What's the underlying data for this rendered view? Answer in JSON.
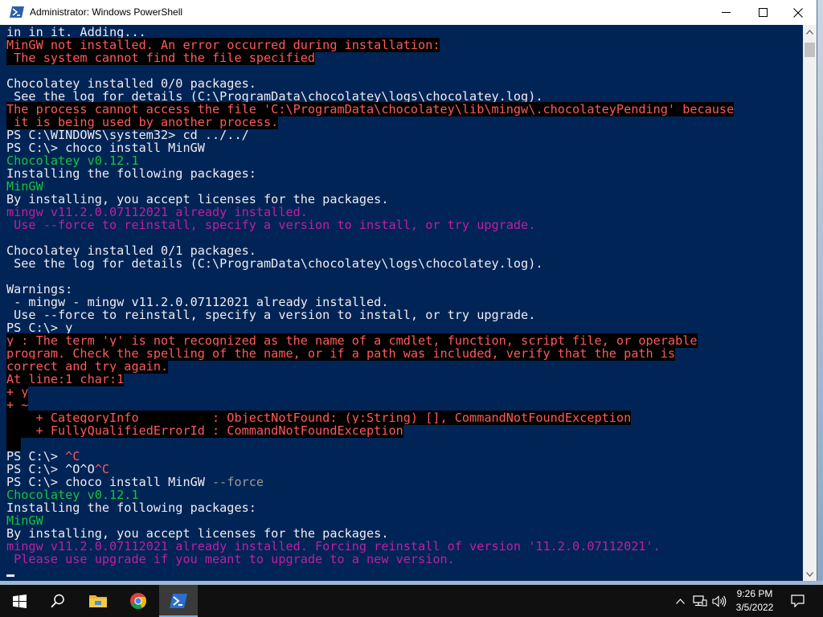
{
  "window": {
    "title": "Administrator: Windows PowerShell",
    "icon": "powershell-icon"
  },
  "caption_buttons": {
    "minimize": "minimize-icon",
    "maximize": "maximize-icon",
    "close": "close-icon"
  },
  "colors": {
    "console_background": "#012456",
    "text_default": "#eeedf0",
    "text_error": "#ff5a5a",
    "text_green": "#13c63c",
    "text_magenta": "#c01ea2",
    "text_parameter": "#9a9a9a",
    "error_background": "#000000"
  },
  "console": {
    "lines": [
      [
        {
          "t": "in in it. Adding...",
          "c": "white"
        }
      ],
      [
        {
          "t": "MinGW not installed. An error occurred during installation:",
          "c": "red",
          "bg": true
        }
      ],
      [
        {
          "t": " The system cannot find the file specified",
          "c": "red",
          "bg": true
        }
      ],
      [
        {
          "t": "",
          "c": "white"
        }
      ],
      [
        {
          "t": "Chocolatey installed 0/0 packages.",
          "c": "white"
        }
      ],
      [
        {
          "t": " See the log for details (C:\\ProgramData\\chocolatey\\logs\\chocolatey.log).",
          "c": "white"
        }
      ],
      [
        {
          "t": "The process cannot access the file 'C:\\ProgramData\\chocolatey\\lib\\mingw\\.chocolateyPending' because",
          "c": "red",
          "bg": true
        }
      ],
      [
        {
          "t": " it is being used by another process.",
          "c": "red",
          "bg": true
        }
      ],
      [
        {
          "t": "PS C:\\WINDOWS\\system32> cd ../../",
          "c": "white"
        }
      ],
      [
        {
          "t": "PS C:\\> choco install MinGW",
          "c": "white"
        }
      ],
      [
        {
          "t": "Chocolatey v0.12.1",
          "c": "green"
        }
      ],
      [
        {
          "t": "Installing the following packages:",
          "c": "white"
        }
      ],
      [
        {
          "t": "MinGW",
          "c": "green"
        }
      ],
      [
        {
          "t": "By installing, you accept licenses for the packages.",
          "c": "white"
        }
      ],
      [
        {
          "t": "mingw v11.2.0.07112021 already installed.",
          "c": "magenta"
        }
      ],
      [
        {
          "t": " Use --force to reinstall, specify a version to install, or try upgrade.",
          "c": "magenta"
        }
      ],
      [
        {
          "t": "",
          "c": "white"
        }
      ],
      [
        {
          "t": "Chocolatey installed 0/1 packages.",
          "c": "white"
        }
      ],
      [
        {
          "t": " See the log for details (C:\\ProgramData\\chocolatey\\logs\\chocolatey.log).",
          "c": "white"
        }
      ],
      [
        {
          "t": "",
          "c": "white"
        }
      ],
      [
        {
          "t": "Warnings:",
          "c": "white"
        }
      ],
      [
        {
          "t": " - mingw - mingw v11.2.0.07112021 already installed.",
          "c": "white"
        }
      ],
      [
        {
          "t": " Use --force to reinstall, specify a version to install, or try upgrade.",
          "c": "white"
        }
      ],
      [
        {
          "t": "PS C:\\> y",
          "c": "white"
        }
      ],
      [
        {
          "t": "y : The term 'y' is not recognized as the name of a cmdlet, function, script file, or operable",
          "c": "red",
          "bg": true
        }
      ],
      [
        {
          "t": "program. Check the spelling of the name, or if a path was included, verify that the path is",
          "c": "red",
          "bg": true
        }
      ],
      [
        {
          "t": "correct and try again.",
          "c": "red",
          "bg": true
        }
      ],
      [
        {
          "t": "At line:1 char:1",
          "c": "red",
          "bg": true
        }
      ],
      [
        {
          "t": "+ y",
          "c": "red",
          "bg": true
        }
      ],
      [
        {
          "t": "+ ~",
          "c": "red",
          "bg": true
        }
      ],
      [
        {
          "t": "    + CategoryInfo          : ObjectNotFound: (y:String) [], CommandNotFoundException",
          "c": "red",
          "bg": true
        }
      ],
      [
        {
          "t": "    + FullyQualifiedErrorId : CommandNotFoundException",
          "c": "red",
          "bg": true
        }
      ],
      [
        {
          "t": "  ",
          "c": "red",
          "bg": true
        }
      ],
      [
        {
          "t": "PS C:\\> ",
          "c": "white"
        },
        {
          "t": "^C",
          "c": "red"
        }
      ],
      [
        {
          "t": "PS C:\\> ^O^O",
          "c": "white"
        },
        {
          "t": "^C",
          "c": "red"
        }
      ],
      [
        {
          "t": "PS C:\\> choco install MinGW ",
          "c": "white"
        },
        {
          "t": "--force",
          "c": "gray"
        }
      ],
      [
        {
          "t": "Chocolatey v0.12.1",
          "c": "green"
        }
      ],
      [
        {
          "t": "Installing the following packages:",
          "c": "white"
        }
      ],
      [
        {
          "t": "MinGW",
          "c": "green"
        }
      ],
      [
        {
          "t": "By installing, you accept licenses for the packages.",
          "c": "white"
        }
      ],
      [
        {
          "t": "mingw v11.2.0.07112021 already installed. Forcing reinstall of version '11.2.0.07112021'.",
          "c": "magenta"
        }
      ],
      [
        {
          "t": " Please use upgrade if you meant to upgrade to a new version.",
          "c": "magenta"
        }
      ]
    ]
  },
  "taskbar": {
    "items": [
      {
        "name": "start-button",
        "icon": "windows-logo-icon"
      },
      {
        "name": "search-button",
        "icon": "search-icon"
      },
      {
        "name": "file-explorer-button",
        "icon": "folder-icon"
      },
      {
        "name": "chrome-button",
        "icon": "chrome-icon"
      },
      {
        "name": "powershell-button",
        "icon": "powershell-icon",
        "active": true
      }
    ],
    "tray": {
      "chevron": "chevron-up-icon",
      "network": "network-icon",
      "volume": "volume-icon",
      "notification": "notification-icon"
    },
    "clock": {
      "time": "9:26 PM",
      "date": "3/5/2022"
    }
  }
}
